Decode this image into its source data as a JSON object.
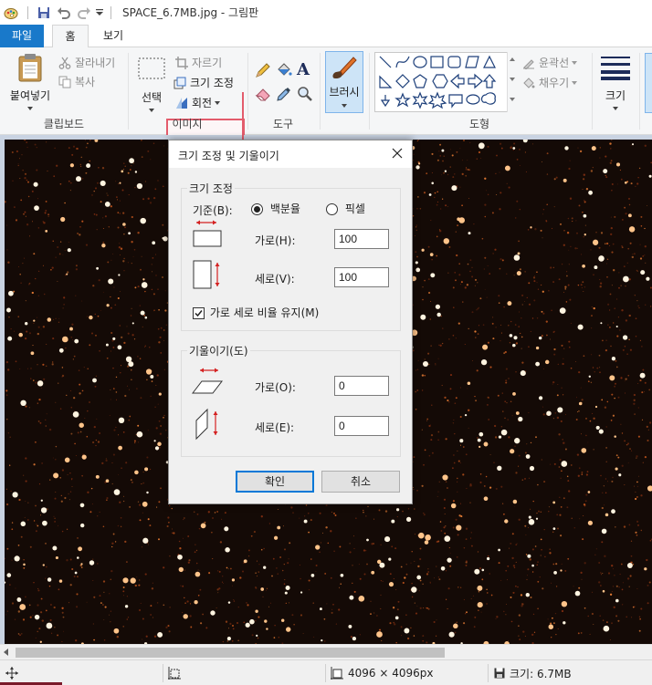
{
  "window": {
    "title": "SPACE_6.7MB.jpg - 그림판"
  },
  "tabs": {
    "file": "파일",
    "home": "홈",
    "view": "보기"
  },
  "ribbon": {
    "clipboard": {
      "paste": "붙여넣기",
      "cut": "잘라내기",
      "copy": "복사",
      "group": "클립보드"
    },
    "image": {
      "select": "선택",
      "crop": "자르기",
      "resize": "크기 조정",
      "rotate": "회전",
      "group": "이미지"
    },
    "tools": {
      "group": "도구"
    },
    "brushes": {
      "label": "브러시"
    },
    "shapes": {
      "outline": "윤곽선",
      "fill": "채우기",
      "group": "도형"
    },
    "size": {
      "label": "크기"
    }
  },
  "dialog": {
    "title": "크기 조정 및 기울이기",
    "resize_section": "크기 조정",
    "by_label": "기준(B):",
    "percent": "백분율",
    "pixels": "픽셀",
    "horizontal_h": "가로(H):",
    "vertical_v": "세로(V):",
    "resize_h_value": "100",
    "resize_v_value": "100",
    "maintain_ratio": "가로 세로 비율 유지(M)",
    "skew_section": "기울이기(도)",
    "horizontal_o": "가로(O):",
    "vertical_e": "세로(E):",
    "skew_h_value": "0",
    "skew_v_value": "0",
    "ok": "확인",
    "cancel": "취소"
  },
  "statusbar": {
    "dimensions": "4096 × 4096px",
    "size": "크기: 6.7MB"
  },
  "colors": {
    "accent": "#1979ca",
    "highlight": "#e35c6c",
    "canvas_bg": "#140a06"
  }
}
